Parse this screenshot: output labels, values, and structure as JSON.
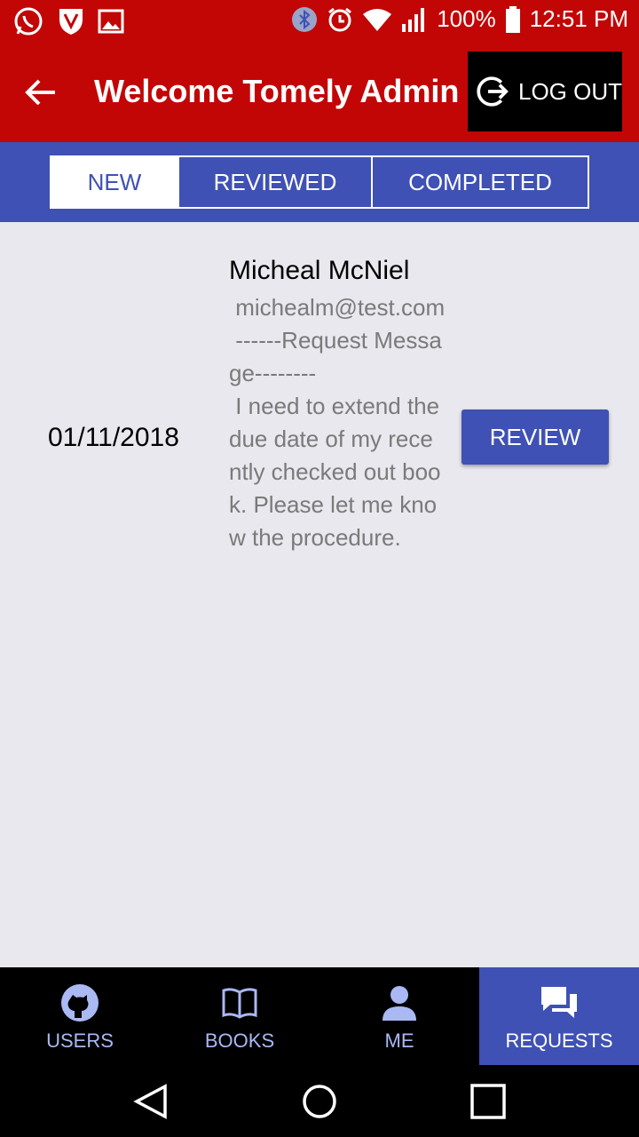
{
  "status_bar": {
    "battery": "100%",
    "time": "12:51 PM",
    "icons": [
      "whatsapp-icon",
      "vpn-shield-icon",
      "gallery-icon",
      "bluetooth-icon",
      "alarm-icon",
      "wifi-icon",
      "signal-icon",
      "battery-icon"
    ]
  },
  "app_bar": {
    "title": "Welcome Tomely Admin",
    "logout_label": "LOG OUT",
    "back_icon": "arrow-back-icon",
    "logout_icon": "logout-icon"
  },
  "tabs": [
    {
      "label": "NEW",
      "active": true
    },
    {
      "label": "REVIEWED",
      "active": false
    },
    {
      "label": "COMPLETED",
      "active": false
    }
  ],
  "requests": [
    {
      "date": "01/11/2018",
      "name": "Micheal McNiel",
      "body": " michealm@test.com\n ------Request Message--------\n I need to extend the due date of my recently checked out book. Please let me know the procedure.",
      "action_label": "REVIEW"
    }
  ],
  "bottom_nav": [
    {
      "label": "USERS",
      "icon": "github-icon",
      "active": false
    },
    {
      "label": "BOOKS",
      "icon": "book-icon",
      "active": false
    },
    {
      "label": "ME",
      "icon": "person-icon",
      "active": false
    },
    {
      "label": "REQUESTS",
      "icon": "chat-icon",
      "active": true
    }
  ],
  "colors": {
    "primary": "#3f51b5",
    "app_bar": "#c20606",
    "background": "#e8e8ee"
  }
}
